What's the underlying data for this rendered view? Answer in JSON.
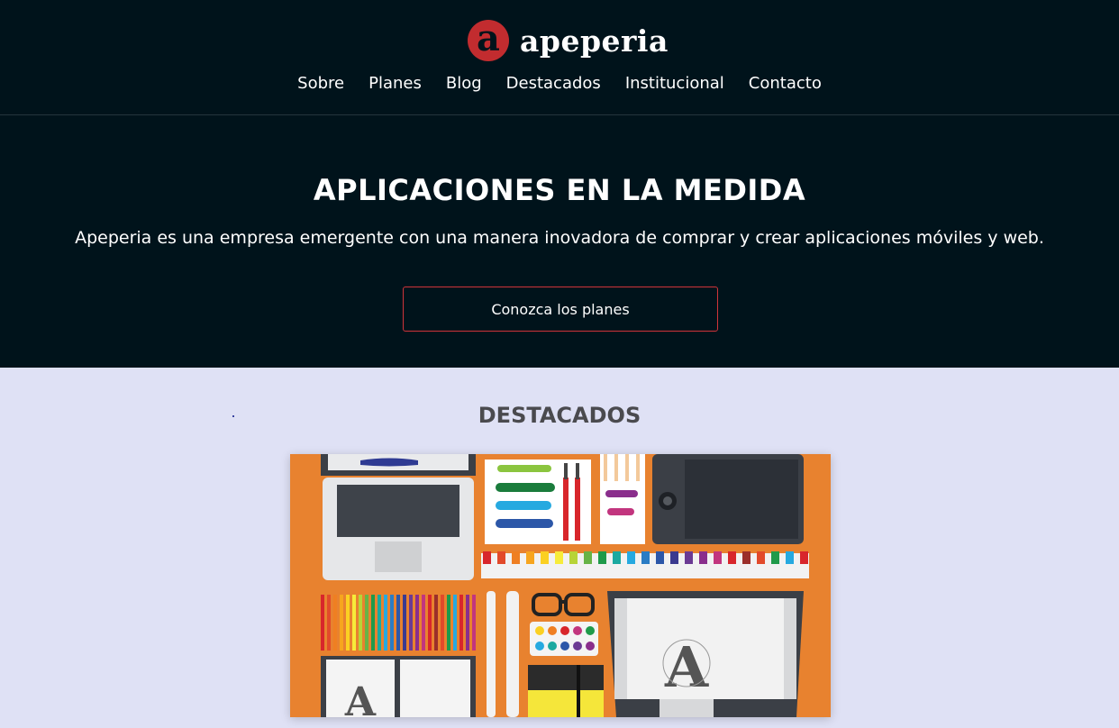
{
  "brand": {
    "logo_letter": "a",
    "name": "apeperia",
    "accent": "#c22c2f"
  },
  "nav": [
    {
      "label": "Sobre"
    },
    {
      "label": "Planes"
    },
    {
      "label": "Blog"
    },
    {
      "label": "Destacados"
    },
    {
      "label": "Institucional"
    },
    {
      "label": "Contacto"
    }
  ],
  "hero": {
    "title": "APLICACIONES EN LA MEDIDA",
    "subtitle": "Apeperia es una empresa emergente con una manera inovadora de comprar y crear aplicaciones móviles y web.",
    "cta": "Conozca los planes"
  },
  "featured": {
    "title": "DESTACADOS"
  },
  "colors": {
    "dark_bg": "#00131b",
    "light_bg": "#dfe1f5",
    "button_border": "#d0343a",
    "art_orange": "#e8822f"
  }
}
